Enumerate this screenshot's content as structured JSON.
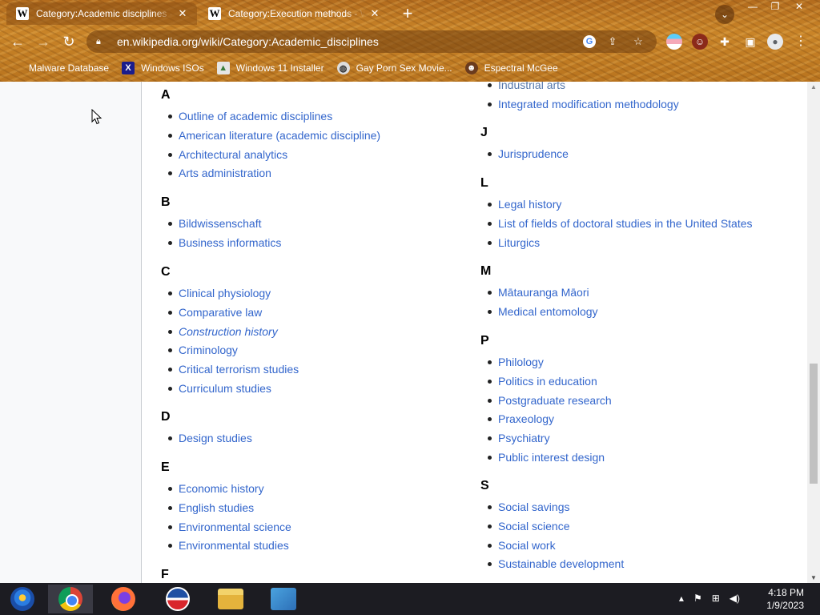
{
  "browser": {
    "tabs": [
      {
        "title": "Category:Academic disciplines - Wikipedia",
        "favicon": "W",
        "active": true
      },
      {
        "title": "Category:Execution methods - Wikipedia",
        "favicon": "W",
        "active": false
      }
    ],
    "new_tab": "+",
    "tab_search": "⌄",
    "window_controls": {
      "minimize": "—",
      "maximize": "❐",
      "close": "✕"
    },
    "url": "en.wikipedia.org/wiki/Category:Academic_disciplines",
    "bookmarks": [
      {
        "label": "Malware Database",
        "icon": "blank-icon"
      },
      {
        "label": "Windows ISOs",
        "icon": "windows-x-icon"
      },
      {
        "label": "Windows 11 Installer",
        "icon": "image-icon"
      },
      {
        "label": "Gay Porn Sex Movie...",
        "icon": "globe-icon"
      },
      {
        "label": "Espectral McGee",
        "icon": "face-icon"
      }
    ]
  },
  "page": {
    "left_column": [
      {
        "letter": "A",
        "items": [
          {
            "text": "Outline of academic disciplines"
          },
          {
            "text": "American literature (academic discipline)"
          },
          {
            "text": "Architectural analytics"
          },
          {
            "text": "Arts administration"
          }
        ]
      },
      {
        "letter": "B",
        "items": [
          {
            "text": "Bildwissenschaft"
          },
          {
            "text": "Business informatics"
          }
        ]
      },
      {
        "letter": "C",
        "items": [
          {
            "text": "Clinical physiology"
          },
          {
            "text": "Comparative law"
          },
          {
            "text": "Construction history",
            "italic": true
          },
          {
            "text": "Criminology"
          },
          {
            "text": "Critical terrorism studies"
          },
          {
            "text": "Curriculum studies"
          }
        ]
      },
      {
        "letter": "D",
        "items": [
          {
            "text": "Design studies"
          }
        ]
      },
      {
        "letter": "E",
        "items": [
          {
            "text": "Economic history"
          },
          {
            "text": "English studies"
          },
          {
            "text": "Environmental science"
          },
          {
            "text": "Environmental studies"
          }
        ]
      },
      {
        "letter": "F",
        "items": []
      }
    ],
    "right_column": [
      {
        "letter": "",
        "items": [
          {
            "text": "Industrial arts",
            "faded": true
          },
          {
            "text": "Integrated modification methodology"
          }
        ]
      },
      {
        "letter": "J",
        "items": [
          {
            "text": "Jurisprudence"
          }
        ]
      },
      {
        "letter": "L",
        "items": [
          {
            "text": "Legal history"
          },
          {
            "text": "List of fields of doctoral studies in the United States"
          },
          {
            "text": "Liturgics"
          }
        ]
      },
      {
        "letter": "M",
        "items": [
          {
            "text": "Mātauranga Māori"
          },
          {
            "text": "Medical entomology"
          }
        ]
      },
      {
        "letter": "P",
        "items": [
          {
            "text": "Philology"
          },
          {
            "text": "Politics in education"
          },
          {
            "text": "Postgraduate research"
          },
          {
            "text": "Praxeology"
          },
          {
            "text": "Psychiatry"
          },
          {
            "text": "Public interest design"
          }
        ]
      },
      {
        "letter": "S",
        "items": [
          {
            "text": "Social savings"
          },
          {
            "text": "Social science"
          },
          {
            "text": "Social work"
          },
          {
            "text": "Sustainable development"
          }
        ]
      }
    ]
  },
  "taskbar": {
    "apps": [
      "start-orb-icon",
      "chrome-icon",
      "firefox-icon",
      "obama-icon",
      "file-explorer-icon",
      "network-icon"
    ],
    "time": "4:18 PM",
    "date": "1/9/2023"
  },
  "colors": {
    "link": "#3366cc",
    "chrome_accent": "#c98428"
  }
}
